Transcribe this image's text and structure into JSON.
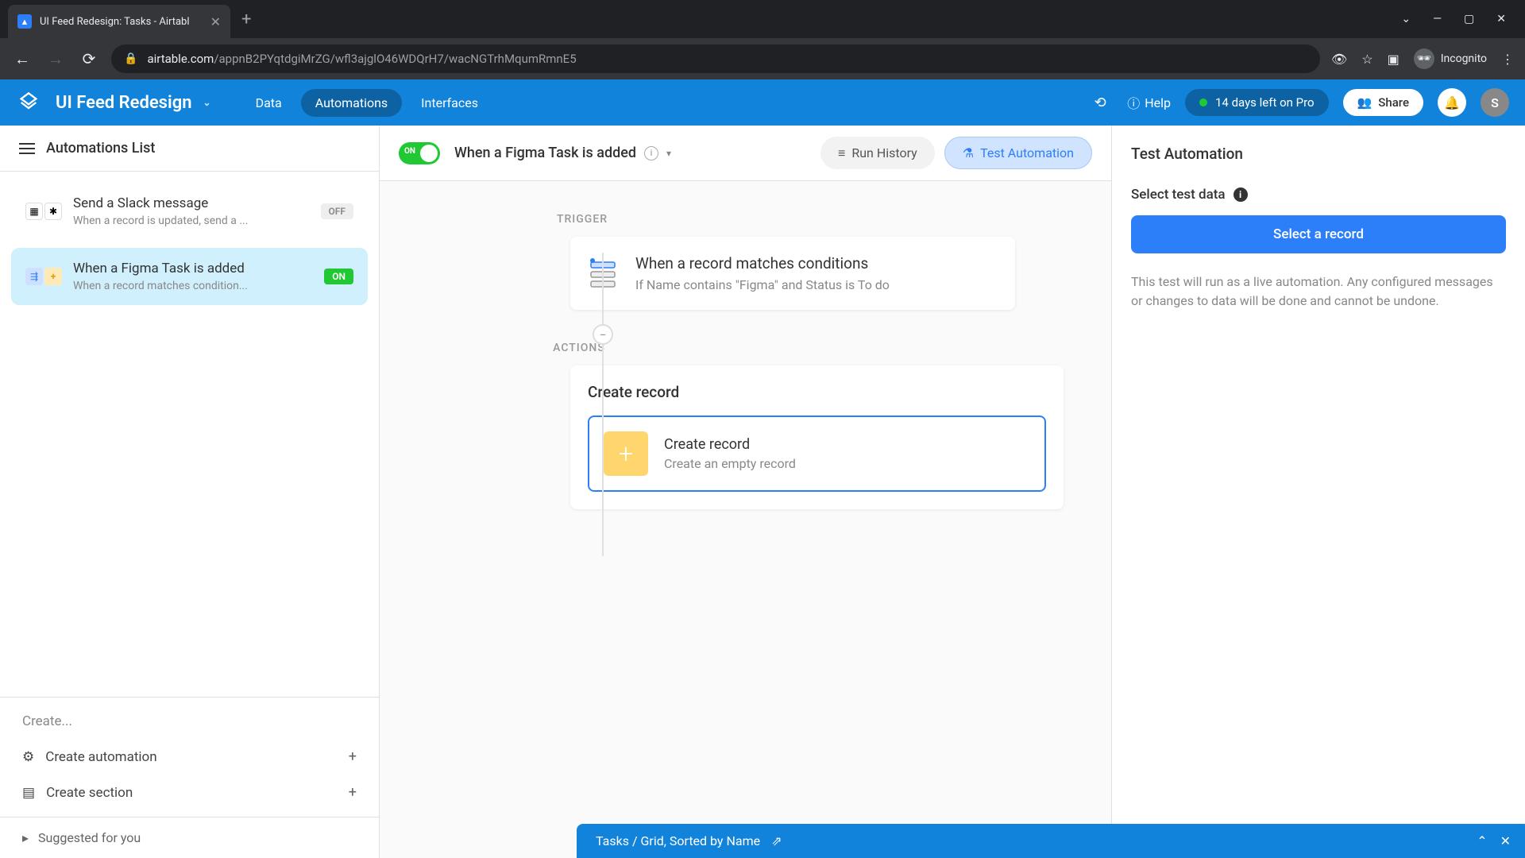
{
  "browser": {
    "tab_title": "UI Feed Redesign: Tasks - Airtabl",
    "url_domain": "airtable.com",
    "url_path": "/appnB2PYqtdgiMrZG/wfl3ajglO46WDQrH7/wacNGTrhMqumRmnE5",
    "incognito_label": "Incognito"
  },
  "header": {
    "base_name": "UI Feed Redesign",
    "tabs": [
      "Data",
      "Automations",
      "Interfaces"
    ],
    "active_tab_index": 1,
    "help_label": "Help",
    "trial_text": "14 days left on Pro",
    "share_label": "Share",
    "avatar_letter": "S"
  },
  "sidebar": {
    "header": "Automations List",
    "items": [
      {
        "title": "Send a Slack message",
        "desc": "When a record is updated, send a ...",
        "badge": "OFF",
        "badge_type": "off"
      },
      {
        "title": "When a Figma Task is added",
        "desc": "When a record matches condition...",
        "badge": "ON",
        "badge_type": "on"
      }
    ],
    "active_index": 1,
    "create_label": "Create...",
    "create_automation": "Create automation",
    "create_section": "Create section",
    "suggested": "Suggested for you"
  },
  "canvas": {
    "toggle_state": "ON",
    "title": "When a Figma Task is added",
    "run_history_label": "Run History",
    "test_automation_label": "Test Automation",
    "trigger_section": "TRIGGER",
    "actions_section": "ACTIONS",
    "trigger": {
      "title": "When a record matches conditions",
      "desc": "If Name contains \"Figma\" and Status is To do"
    },
    "action_group_title": "Create record",
    "action": {
      "title": "Create record",
      "desc": "Create an empty record"
    }
  },
  "right_panel": {
    "title": "Test Automation",
    "select_label": "Select test data",
    "select_button": "Select a record",
    "help_text": "This test will run as a live automation. Any configured messages or changes to data will be done and cannot be undone."
  },
  "bottom_bar": {
    "text": "Tasks / Grid, Sorted by Name"
  }
}
